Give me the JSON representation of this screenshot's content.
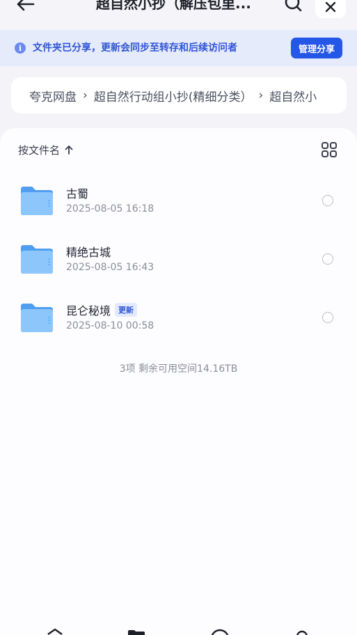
{
  "header": {
    "title": "超自然小抄（解压包里..."
  },
  "notice": {
    "text": "文件夹已分享，更新会同步至转存和后续访问者",
    "manage_label": "管理分享"
  },
  "breadcrumb": {
    "items": [
      "夸克网盘",
      "超自然行动组小抄(精细分类）",
      "超自然小"
    ],
    "separator": "›"
  },
  "list": {
    "sort_label": "按文件名",
    "items": [
      {
        "name": "古蜀",
        "date": "2025-08-05 16:18",
        "badge": ""
      },
      {
        "name": "精绝古城",
        "date": "2025-08-05 16:43",
        "badge": ""
      },
      {
        "name": "昆仑秘境",
        "date": "2025-08-10 00:58",
        "badge": "更新"
      }
    ],
    "summary": "3项 剩余可用空间14.16TB"
  },
  "colors": {
    "accent": "#2456e8",
    "notice_bg": "#e6ebfb",
    "folder": "#5aa8f4"
  },
  "icons": [
    "back-arrow-icon",
    "search-icon",
    "close-icon",
    "info-icon",
    "sort-up-icon",
    "grid-view-icon",
    "folder-icon",
    "home-icon",
    "files-icon",
    "chat-icon",
    "profile-icon"
  ]
}
